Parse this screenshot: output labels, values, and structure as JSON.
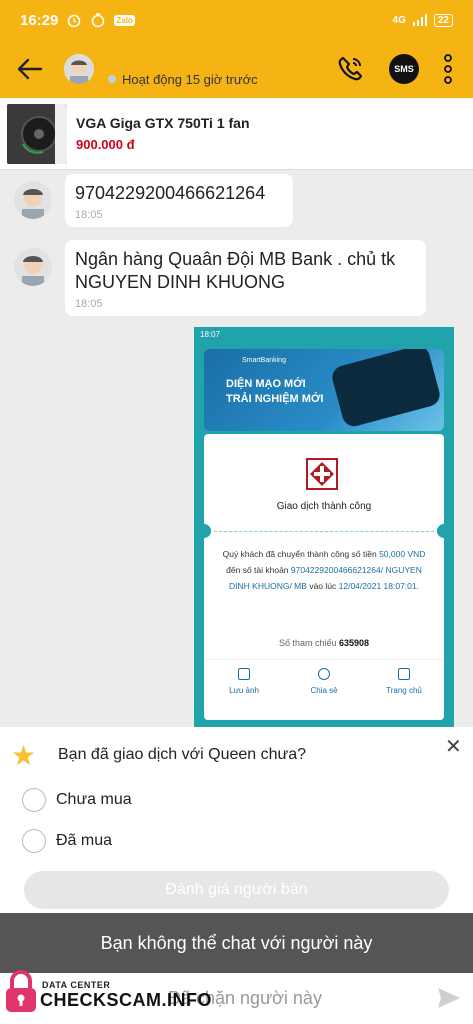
{
  "status_bar": {
    "time": "16:29",
    "app_badge": "Zalo",
    "network": "4G",
    "battery": "22"
  },
  "header": {
    "status_text": "Hoạt động 15 giờ trước",
    "sms_label": "SMS"
  },
  "product": {
    "name": "VGA Giga GTX 750Ti 1 fan",
    "price": "900.000 đ"
  },
  "messages": [
    {
      "text": "9704229200466621264",
      "time": "18:05"
    },
    {
      "text": "Ngân hàng Quaân Đội MB Bank . chủ tk NGUYEN DINH KHUONG",
      "time": "18:05"
    }
  ],
  "receipt_image": {
    "status_time": "18:07",
    "brand": "SmartBanking",
    "banner_line1": "DIỆN MẠO MỚI",
    "banner_line2": "TRẢI NGHIỆM MỚI",
    "title": "Giao dịch thành công",
    "body_1": "Quý khách đã chuyển thành công số tiền",
    "amount": "50,000 VND",
    "body_2": "đến số tài khoản",
    "account": "9704229200466621264/ NGUYEN DINH KHUONG/ MB",
    "body_3": "vào lúc",
    "datetime": "12/04/2021 18:07:01.",
    "ref_label": "Số tham chiếu",
    "ref_value": "635908",
    "actions": [
      "Lưu ảnh",
      "Chia sẻ",
      "Trang chủ"
    ]
  },
  "review": {
    "question": "Bạn đã giao dịch với Queen chưa?",
    "options": [
      "Chưa mua",
      "Đã mua"
    ],
    "button": "Đánh giá người bán"
  },
  "blocked_message": "Bạn không thể chat với người này",
  "bottom_bar": {
    "placeholder": "Đã chặn người này"
  },
  "watermark": {
    "small": "DATA CENTER",
    "big": "CHECKSCAM.INFO"
  },
  "colors": {
    "brand": "#f6b414",
    "price": "#d0021b",
    "receipt_teal": "#21a3ab"
  }
}
